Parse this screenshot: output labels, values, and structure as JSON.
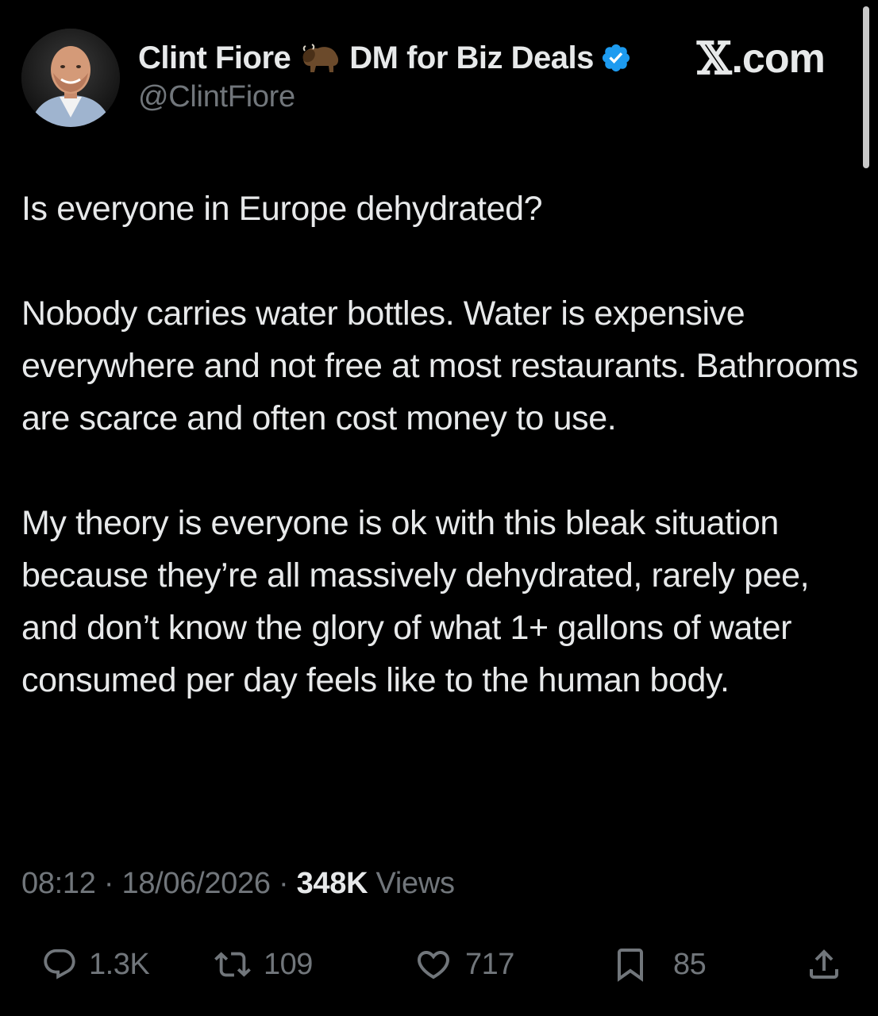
{
  "author": {
    "display_name": "Clint Fiore",
    "name_suffix": "DM for Biz Deals",
    "handle": "@ClintFiore",
    "badge_icon": "verified-badge-icon",
    "emoji_icon": "bison-emoji-icon"
  },
  "watermark": {
    "x_glyph": "𝕏",
    "text": ".com"
  },
  "tweet": {
    "paragraphs": [
      "Is everyone in Europe dehydrated?",
      "Nobody carries water bottles. Water is expensive everywhere and not free at most restaurants. Bathrooms are scarce and often cost money to use.",
      "My theory is everyone is ok with this bleak situation because they’re all massively dehydrated, rarely pee, and don’t know the glory of what 1+ gallons of water consumed per day feels like to the human body."
    ]
  },
  "meta": {
    "time": "08:12",
    "separator": "·",
    "date": "18/06/2026",
    "views_count": "348K",
    "views_label": "Views"
  },
  "actions": {
    "replies": "1.3K",
    "reposts": "109",
    "likes": "717",
    "bookmarks": "85"
  },
  "colors": {
    "background": "#000000",
    "text_primary": "#e7e9ea",
    "text_secondary": "#71767b",
    "verified_blue": "#1d9bf0"
  }
}
